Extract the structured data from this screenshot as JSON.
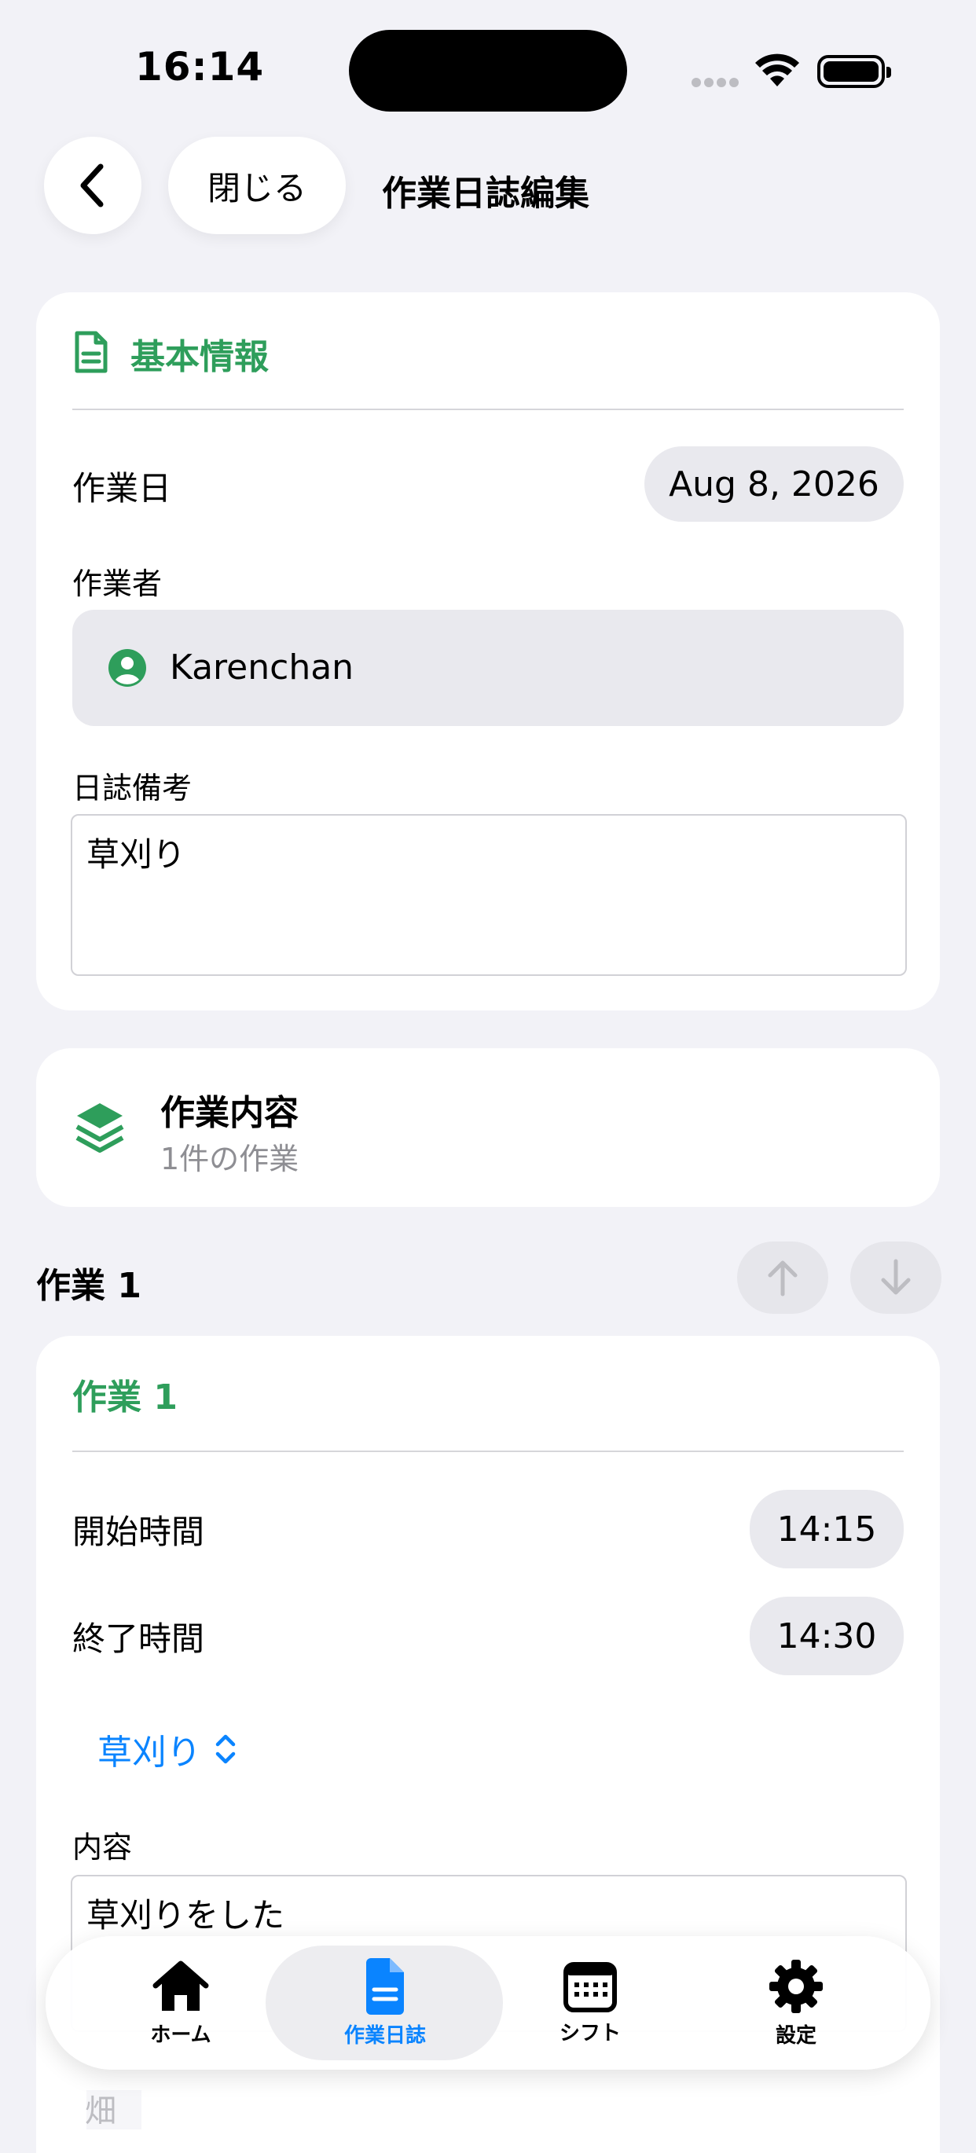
{
  "status_bar": {
    "time": "16:14"
  },
  "nav": {
    "close_label": "閉じる",
    "title": "作業日誌編集"
  },
  "basic_info": {
    "title": "基本情報",
    "date_label": "作業日",
    "date_value": "Aug 8, 2026",
    "worker_label": "作業者",
    "worker_name": "Karenchan",
    "memo_label": "日誌備考",
    "memo_value": "草刈り"
  },
  "work_summary": {
    "title": "作業内容",
    "subtitle": "1件の作業"
  },
  "work_item": {
    "header": "作業 1",
    "card_title": "作業 1",
    "start_label": "開始時間",
    "start_value": "14:15",
    "end_label": "終了時間",
    "end_value": "14:30",
    "type_value": "草刈り",
    "content_label": "内容",
    "content_value": "草刈りをした",
    "hidden_label_fragment": "畑"
  },
  "tabbar": {
    "items": [
      {
        "label": "ホーム",
        "icon": "house-icon"
      },
      {
        "label": "作業日誌",
        "icon": "document-icon"
      },
      {
        "label": "シフト",
        "icon": "calendar-icon"
      },
      {
        "label": "設定",
        "icon": "gear-icon"
      }
    ]
  },
  "colors": {
    "accent_green": "#2E9E5B",
    "accent_blue": "#0A84FF",
    "background": "#F2F2F7"
  }
}
